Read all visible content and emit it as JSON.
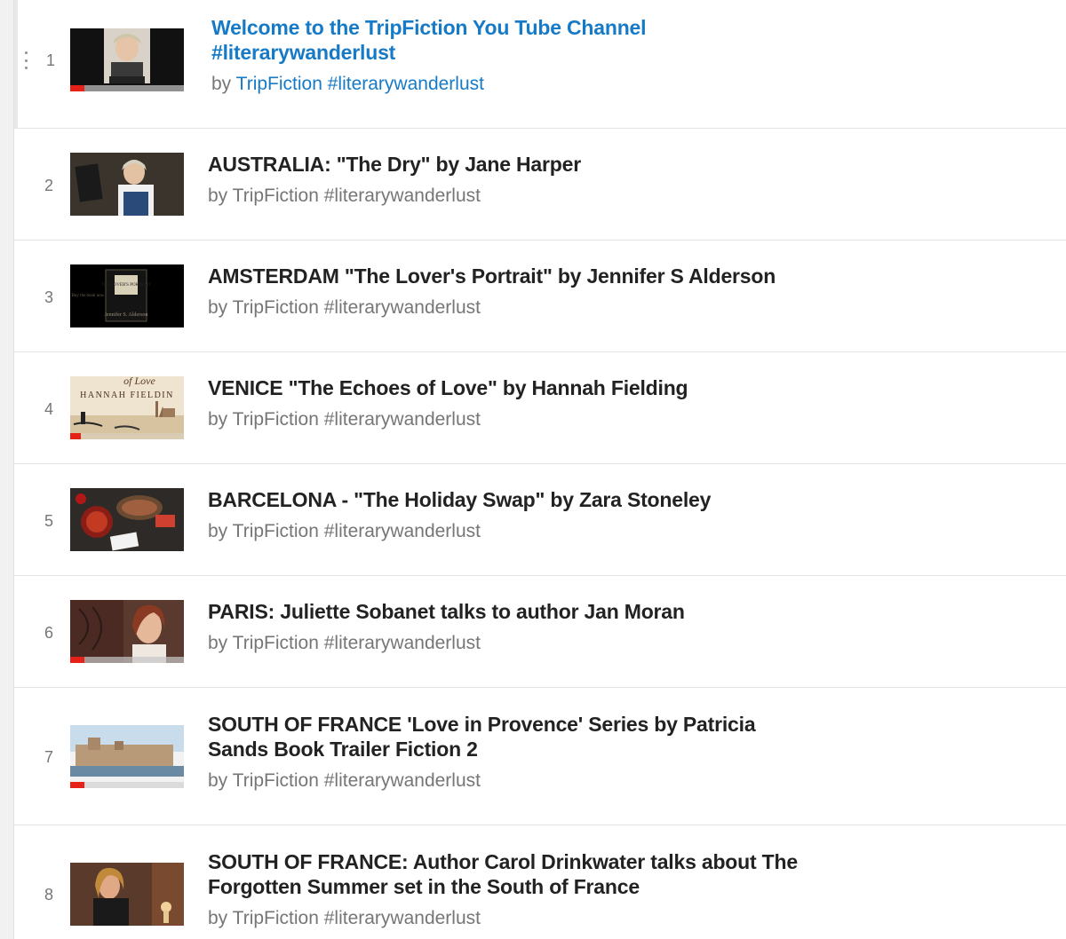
{
  "playlist": {
    "by_prefix": "by",
    "items": [
      {
        "index": "1",
        "title": "Welcome to the TripFiction You Tube Channel #literarywanderlust",
        "channel": "TripFiction #literarywanderlust",
        "active": true,
        "thumb": "woman-speaking"
      },
      {
        "index": "2",
        "title": "AUSTRALIA: \"The Dry\" by Jane Harper",
        "channel": "TripFiction #literarywanderlust",
        "active": false,
        "thumb": "woman-with-book"
      },
      {
        "index": "3",
        "title": "AMSTERDAM \"The Lover's Portrait\" by Jennifer S Alderson",
        "channel": "TripFiction #literarywanderlust",
        "active": false,
        "thumb": "book-cover-black"
      },
      {
        "index": "4",
        "title": "VENICE \"The Echoes of Love\" by Hannah Fielding",
        "channel": "TripFiction #literarywanderlust",
        "active": false,
        "thumb": "venice-cover"
      },
      {
        "index": "5",
        "title": "BARCELONA - \"The Holiday Swap\" by Zara Stoneley",
        "channel": "TripFiction #literarywanderlust",
        "active": false,
        "thumb": "tapas-table"
      },
      {
        "index": "6",
        "title": "PARIS: Juliette Sobanet talks to author Jan Moran",
        "channel": "TripFiction #literarywanderlust",
        "active": false,
        "thumb": "woman-portrait"
      },
      {
        "index": "7",
        "title": "SOUTH OF FRANCE 'Love in Provence' Series by Patricia Sands Book Trailer Fiction 2",
        "channel": "TripFiction #literarywanderlust",
        "active": false,
        "thumb": "coastal-town"
      },
      {
        "index": "8",
        "title": "SOUTH OF FRANCE: Author Carol Drinkwater talks about The Forgotten Summer set in the South of France",
        "channel": "TripFiction #literarywanderlust",
        "active": false,
        "thumb": "woman-at-table"
      }
    ],
    "thumb_labels": {
      "book_cover_title": "THE LOVER'S PORTRAIT",
      "book_cover_author": "Jennifer S. Alderson",
      "book_cover_side": "Buy the book now",
      "venice_title": "of Love",
      "venice_author": "HANNAH FIELDIN"
    },
    "colors": {
      "accent": "#167ac6",
      "progress": "#e62117",
      "text": "#222222",
      "muted": "#767676"
    }
  }
}
